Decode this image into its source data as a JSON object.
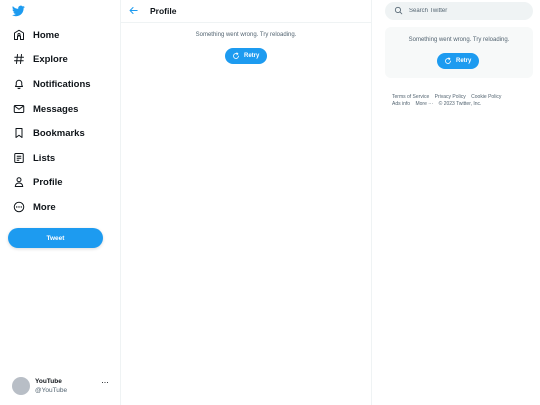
{
  "nav": {
    "items": [
      {
        "label": "Home",
        "icon": "home-icon"
      },
      {
        "label": "Explore",
        "icon": "hashtag-icon"
      },
      {
        "label": "Notifications",
        "icon": "bell-icon"
      },
      {
        "label": "Messages",
        "icon": "envelope-icon"
      },
      {
        "label": "Bookmarks",
        "icon": "bookmark-icon"
      },
      {
        "label": "Lists",
        "icon": "list-icon"
      },
      {
        "label": "Profile",
        "icon": "person-icon"
      },
      {
        "label": "More",
        "icon": "more-circle-icon"
      }
    ],
    "tweet_button": "Tweet"
  },
  "account": {
    "name": "YouTube",
    "handle": "@YouTube",
    "more": "···"
  },
  "main": {
    "title": "Profile",
    "error_text": "Something went wrong. Try reloading.",
    "retry_label": "Retry"
  },
  "right": {
    "search_placeholder": "Search Twitter",
    "card_error_text": "Something went wrong. Try reloading.",
    "card_retry_label": "Retry",
    "footer": {
      "terms": "Terms of Service",
      "privacy": "Privacy Policy",
      "cookie": "Cookie Policy",
      "ads": "Ads info",
      "more": "More ···",
      "copyright": "© 2023 Twitter, Inc."
    }
  },
  "colors": {
    "accent": "#1d9bf0",
    "text_primary": "#0f1419",
    "text_secondary": "#536471"
  }
}
